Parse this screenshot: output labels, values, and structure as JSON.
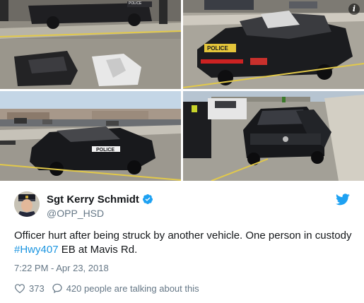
{
  "media": {
    "photos": [
      {
        "name": "crash-photo-wide-shot",
        "police_text": "POLICE"
      },
      {
        "name": "crash-photo-rear-cruiser",
        "police_text": "POLICE"
      },
      {
        "name": "crash-photo-side-cruiser",
        "police_text": "POLICE"
      },
      {
        "name": "crash-photo-black-sedan",
        "police_text": ""
      }
    ],
    "info_icon": "i"
  },
  "author": {
    "display_name": "Sgt Kerry Schmidt",
    "handle": "@OPP_HSD",
    "verified": true,
    "avatar_icon": "avatar-officer-icon"
  },
  "tweet": {
    "text_before": "Officer hurt after being struck by another vehicle. One person in custody ",
    "hashtag": "#Hwy407",
    "text_after": " EB at Mavis Rd."
  },
  "timestamp": "7:22 PM - Apr 23, 2018",
  "actions": {
    "likes_count": "373",
    "talking_text": "420 people are talking about this"
  },
  "colors": {
    "link": "#1b95e0",
    "twitter_brand": "#1da1f2",
    "secondary_text": "#657786",
    "primary_text": "#14171a"
  }
}
